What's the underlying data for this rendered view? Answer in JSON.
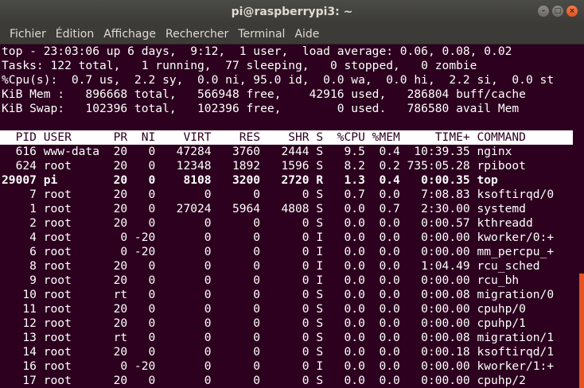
{
  "window": {
    "title": "pi@raspberrypi3: ~",
    "controls": {
      "minimize": "–",
      "maximize": "□",
      "close": "×"
    }
  },
  "menu": [
    "Fichier",
    "Édition",
    "Affichage",
    "Rechercher",
    "Terminal",
    "Aide"
  ],
  "summary": [
    "top - 23:03:06 up 6 days,  9:12,  1 user,  load average: 0.06, 0.08, 0.02",
    "Tasks: 122 total,   1 running,  77 sleeping,   0 stopped,   0 zombie",
    "%Cpu(s):  0.7 us,  2.2 sy,  0.0 ni, 95.0 id,  0.0 wa,  0.0 hi,  2.2 si,  0.0 st",
    "KiB Mem :   896668 total,   566948 free,    42916 used,   286804 buff/cache",
    "KiB Swap:   102396 total,   102396 free,        0 used.   786580 avail Mem"
  ],
  "table_header": "  PID USER      PR  NI    VIRT    RES    SHR S  %CPU %MEM     TIME+ COMMAND",
  "processes": [
    {
      "text": "  616 www-data  20   0   47284   3760   2444 S   9.5  0.4  10:39.35 nginx",
      "bold": false
    },
    {
      "text": "  624 root      20   0   12348   1892   1596 S   8.2  0.2 735:05.28 rpiboot",
      "bold": false
    },
    {
      "text": "29007 pi        20   0    8108   3200   2720 R   1.3  0.4   0:00.35 top",
      "bold": true
    },
    {
      "text": "    7 root      20   0       0      0      0 S   0.7  0.0   7:08.83 ksoftirqd/0",
      "bold": false
    },
    {
      "text": "    1 root      20   0   27024   5964   4808 S   0.0  0.7   2:30.00 systemd",
      "bold": false
    },
    {
      "text": "    2 root      20   0       0      0      0 S   0.0  0.0   0:00.57 kthreadd",
      "bold": false
    },
    {
      "text": "    4 root       0 -20       0      0      0 I   0.0  0.0   0:00.00 kworker/0:+",
      "bold": false
    },
    {
      "text": "    6 root       0 -20       0      0      0 I   0.0  0.0   0:00.00 mm_percpu_+",
      "bold": false
    },
    {
      "text": "    8 root      20   0       0      0      0 I   0.0  0.0   1:04.49 rcu_sched",
      "bold": false
    },
    {
      "text": "    9 root      20   0       0      0      0 I   0.0  0.0   0:00.00 rcu_bh",
      "bold": false
    },
    {
      "text": "   10 root      rt   0       0      0      0 S   0.0  0.0   0:00.08 migration/0",
      "bold": false
    },
    {
      "text": "   11 root      20   0       0      0      0 S   0.0  0.0   0:00.00 cpuhp/0",
      "bold": false
    },
    {
      "text": "   12 root      20   0       0      0      0 S   0.0  0.0   0:00.00 cpuhp/1",
      "bold": false
    },
    {
      "text": "   13 root      rt   0       0      0      0 S   0.0  0.0   0:00.08 migration/1",
      "bold": false
    },
    {
      "text": "   14 root      20   0       0      0      0 S   0.0  0.0   0:00.18 ksoftirqd/1",
      "bold": false
    },
    {
      "text": "   16 root       0 -20       0      0      0 I   0.0  0.0   0:00.00 kworker/1:+",
      "bold": false
    },
    {
      "text": "   17 root      20   0       0      0      0 S   0.0  0.0   0:00.00 cpuhp/2",
      "bold": false
    }
  ],
  "colors": {
    "terminal_bg": "#2c001e",
    "terminal_fg": "#ffffff",
    "scrollbar_accent": "#e95420",
    "chrome": "#3c3b37"
  }
}
